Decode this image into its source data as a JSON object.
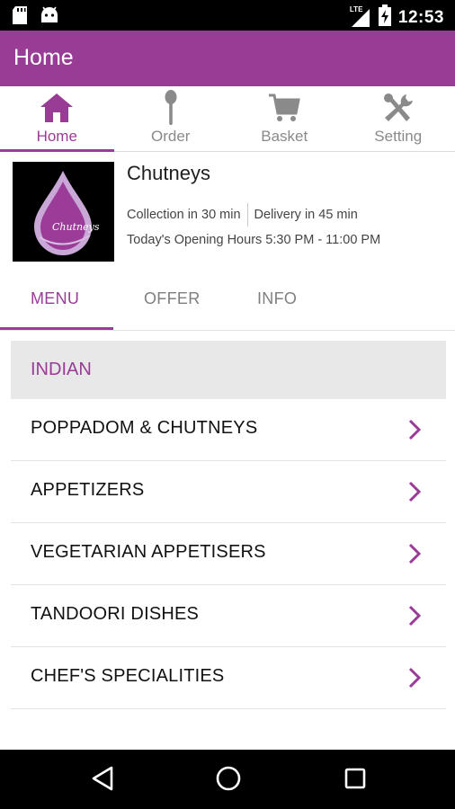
{
  "status_bar": {
    "time": "12:53",
    "network_label": "LTE",
    "left_icons": [
      "sd-card-icon",
      "android-icon"
    ],
    "right_icons": [
      "lte-signal-icon",
      "battery-charging-icon"
    ]
  },
  "app_bar": {
    "title": "Home"
  },
  "top_tabs": [
    {
      "label": "Home",
      "icon": "home-icon",
      "active": true
    },
    {
      "label": "Order",
      "icon": "spoon-icon",
      "active": false
    },
    {
      "label": "Basket",
      "icon": "cart-icon",
      "active": false
    },
    {
      "label": "Setting",
      "icon": "tools-icon",
      "active": false
    }
  ],
  "restaurant": {
    "name": "Chutneys",
    "logo_text": "Chutneys",
    "collection": "Collection in 30 min",
    "delivery": "Delivery in 45 min",
    "hours": "Today's Opening Hours 5:30 PM - 11:00 PM"
  },
  "sub_tabs": [
    {
      "label": "MENU",
      "active": true
    },
    {
      "label": "OFFER",
      "active": false
    },
    {
      "label": "INFO",
      "active": false
    }
  ],
  "category": {
    "label": "INDIAN"
  },
  "menu_items": [
    {
      "label": "POPPADOM & CHUTNEYS"
    },
    {
      "label": "APPETIZERS"
    },
    {
      "label": "VEGETARIAN APPETISERS"
    },
    {
      "label": "TANDOORI DISHES"
    },
    {
      "label": "CHEF'S SPECIALITIES"
    }
  ],
  "colors": {
    "brand": "#983c96",
    "category_bg": "#e8e8e8",
    "inactive_text": "#8a8a8a"
  },
  "nav_bar": {
    "buttons": [
      "back-icon",
      "home-circle-icon",
      "recents-icon"
    ]
  }
}
